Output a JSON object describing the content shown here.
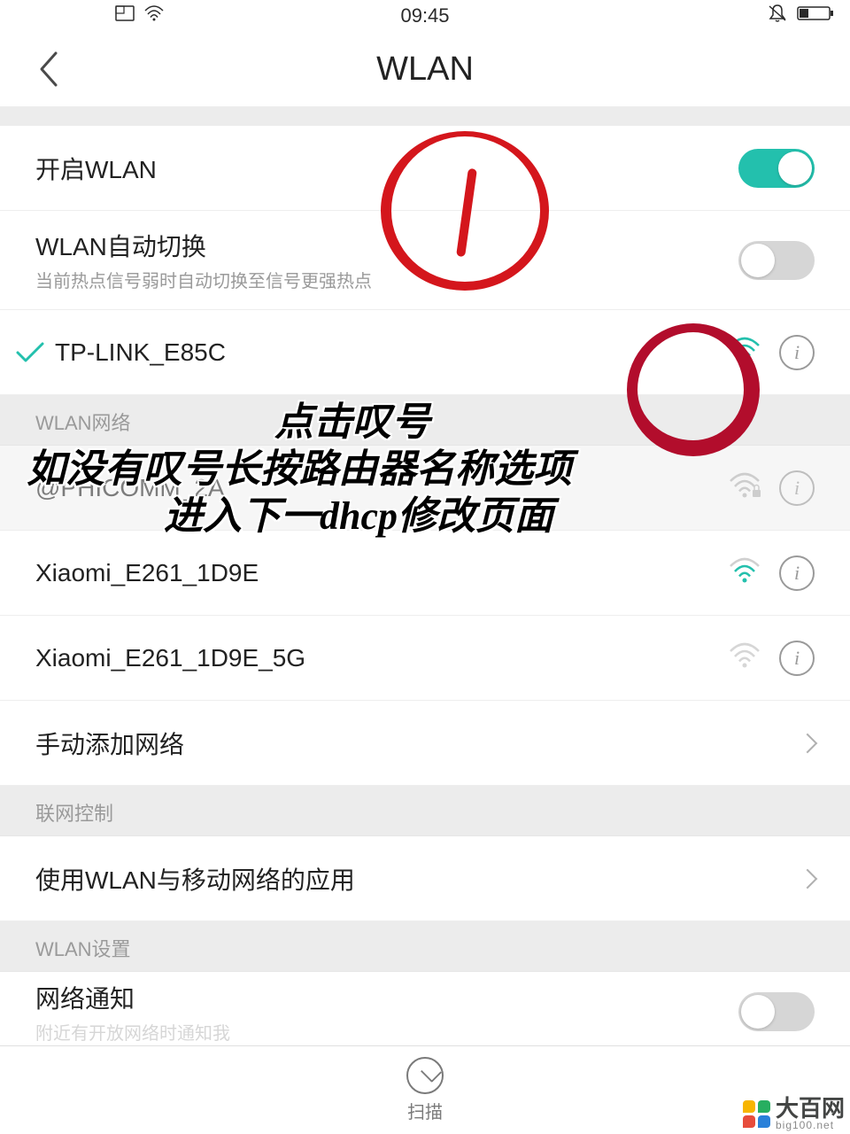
{
  "status": {
    "time": "09:45"
  },
  "nav": {
    "title": "WLAN"
  },
  "toggles": {
    "wlan_on_label": "开启WLAN",
    "wlan_on_state": true,
    "auto_switch_label": "WLAN自动切换",
    "auto_switch_sub": "当前热点信号弱时自动切换至信号更强热点",
    "auto_switch_state": false
  },
  "connected": {
    "name": "TP-LINK_E85C"
  },
  "sections": {
    "networks_header": "WLAN网络",
    "control_header": "联网控制",
    "settings_header": "WLAN设置"
  },
  "networks": [
    {
      "name": "@PHICOMM_2A",
      "locked": true,
      "faint": true
    },
    {
      "name": "Xiaomi_E261_1D9E",
      "locked": false,
      "faint": false
    },
    {
      "name": "Xiaomi_E261_1D9E_5G",
      "locked": false,
      "faint": true
    }
  ],
  "manual_add_label": "手动添加网络",
  "control_row_label": "使用WLAN与移动网络的应用",
  "notify_label": "网络通知",
  "notify_sub": "附近有开放网络时通知我",
  "notify_state": false,
  "bottom": {
    "scan_label": "扫描"
  },
  "annotations": {
    "line1": "点击叹号",
    "line2": "如没有叹号长按路由器名称选项",
    "line3": "进入下一dhcp修改页面"
  },
  "watermark": {
    "text_big": "大百网",
    "text_small": "big100.net"
  }
}
